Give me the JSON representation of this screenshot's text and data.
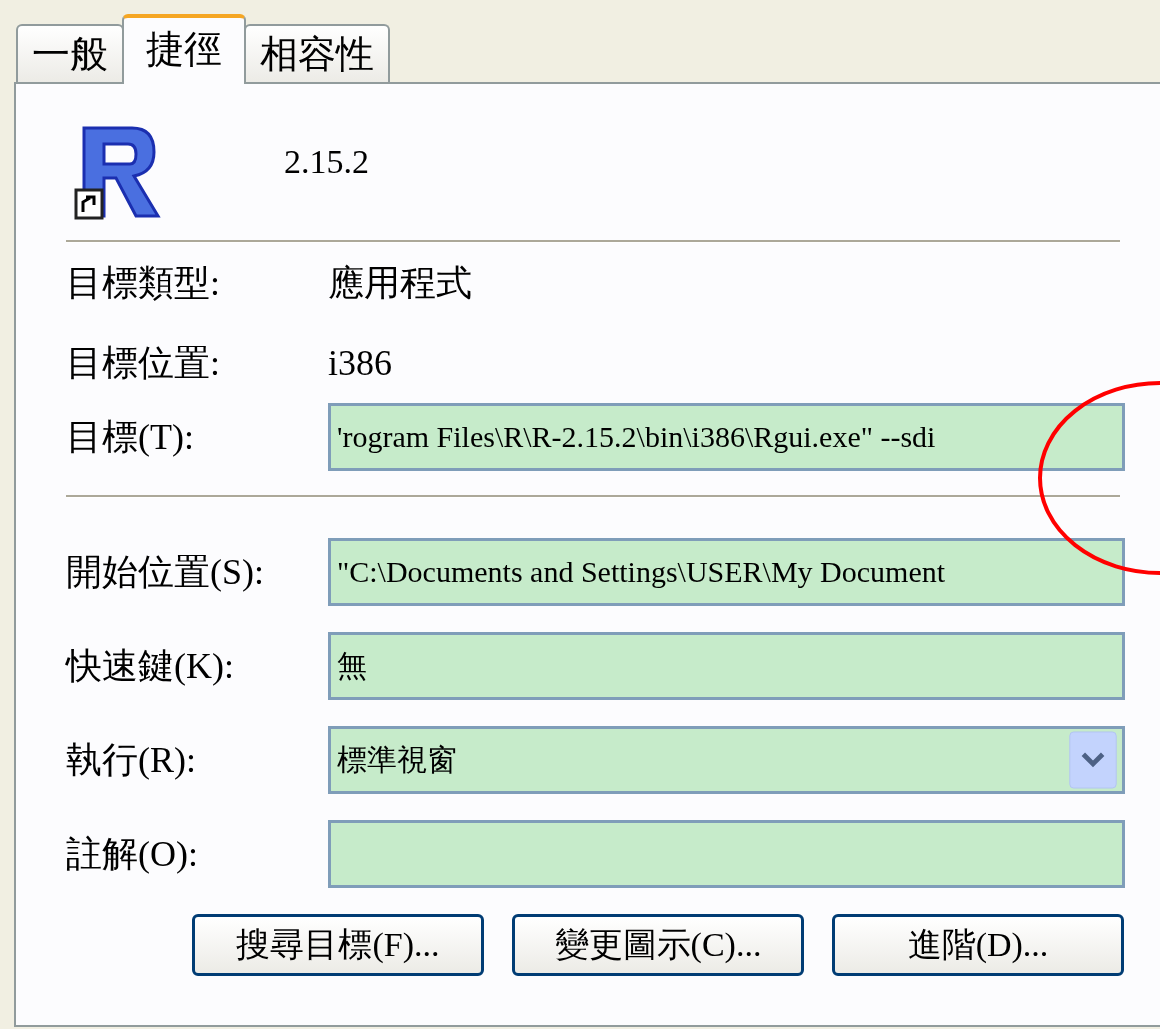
{
  "tabs": [
    {
      "label": "一般",
      "selected": false
    },
    {
      "label": "捷徑",
      "selected": true
    },
    {
      "label": "相容性",
      "selected": false
    }
  ],
  "header": {
    "name": "2.15.2"
  },
  "info": [
    {
      "label": "目標類型:",
      "value": "應用程式"
    },
    {
      "label": "目標位置:",
      "value": "i386"
    }
  ],
  "target": {
    "label": "目標(T):",
    "value": "'rogram Files\\R\\R-2.15.2\\bin\\i386\\Rgui.exe\" --sdi"
  },
  "fields": [
    {
      "label": "開始位置(S):",
      "kind": "text",
      "value": "\"C:\\Documents and Settings\\USER\\My Document"
    },
    {
      "label": "快速鍵(K):",
      "kind": "text",
      "value": "無"
    },
    {
      "label": "執行(R):",
      "kind": "dropdown",
      "value": "標準視窗"
    },
    {
      "label": "註解(O):",
      "kind": "text"
    }
  ],
  "buttons": [
    "搜尋目標(F)...",
    "變更圖示(C)...",
    "進階(D)..."
  ]
}
